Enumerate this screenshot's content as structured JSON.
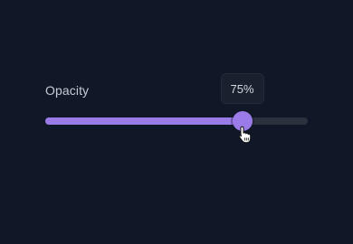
{
  "slider": {
    "label": "Opacity",
    "value_text": "75%",
    "value_fraction": 0.75,
    "accent_color": "#9b7be8",
    "track_color": "#2b313d"
  },
  "cursor": {
    "icon": "hand-pointer-icon"
  }
}
